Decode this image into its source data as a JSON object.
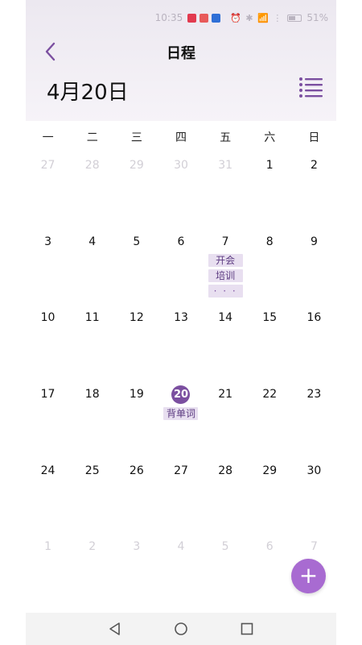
{
  "status_bar": {
    "time": "10:35",
    "icons": "⏰ ✱ 📶 ⋮",
    "battery": "51%",
    "app_colors": [
      "#e23a4f",
      "#e85a5a",
      "#2f6fd6"
    ]
  },
  "header": {
    "title": "日程",
    "date_label": "4月20日"
  },
  "weekdays": [
    "一",
    "二",
    "三",
    "四",
    "五",
    "六",
    "日"
  ],
  "weeks": [
    [
      {
        "day": "27",
        "muted": true
      },
      {
        "day": "28",
        "muted": true
      },
      {
        "day": "29",
        "muted": true
      },
      {
        "day": "30",
        "muted": true
      },
      {
        "day": "31",
        "muted": true
      },
      {
        "day": "1"
      },
      {
        "day": "2"
      }
    ],
    [
      {
        "day": "3"
      },
      {
        "day": "4"
      },
      {
        "day": "5"
      },
      {
        "day": "6"
      },
      {
        "day": "7",
        "events": [
          "开会",
          "培训",
          "· · ·"
        ]
      },
      {
        "day": "8"
      },
      {
        "day": "9"
      }
    ],
    [
      {
        "day": "10"
      },
      {
        "day": "11"
      },
      {
        "day": "12"
      },
      {
        "day": "13"
      },
      {
        "day": "14"
      },
      {
        "day": "15"
      },
      {
        "day": "16"
      }
    ],
    [
      {
        "day": "17"
      },
      {
        "day": "18"
      },
      {
        "day": "19"
      },
      {
        "day": "20",
        "today": true,
        "events": [
          "背单词"
        ]
      },
      {
        "day": "21"
      },
      {
        "day": "22"
      },
      {
        "day": "23"
      }
    ],
    [
      {
        "day": "24"
      },
      {
        "day": "25"
      },
      {
        "day": "26"
      },
      {
        "day": "27"
      },
      {
        "day": "28"
      },
      {
        "day": "29"
      },
      {
        "day": "30"
      }
    ],
    [
      {
        "day": "1",
        "muted": true
      },
      {
        "day": "2",
        "muted": true
      },
      {
        "day": "3",
        "muted": true
      },
      {
        "day": "4",
        "muted": true
      },
      {
        "day": "5",
        "muted": true
      },
      {
        "day": "6",
        "muted": true
      },
      {
        "day": "7",
        "muted": true
      }
    ]
  ],
  "fab": {
    "icon": "plus-icon",
    "label": "+"
  },
  "colors": {
    "accent": "#7b4fa0",
    "fab": "#a86bd1",
    "event_bg": "#e8dff0"
  }
}
